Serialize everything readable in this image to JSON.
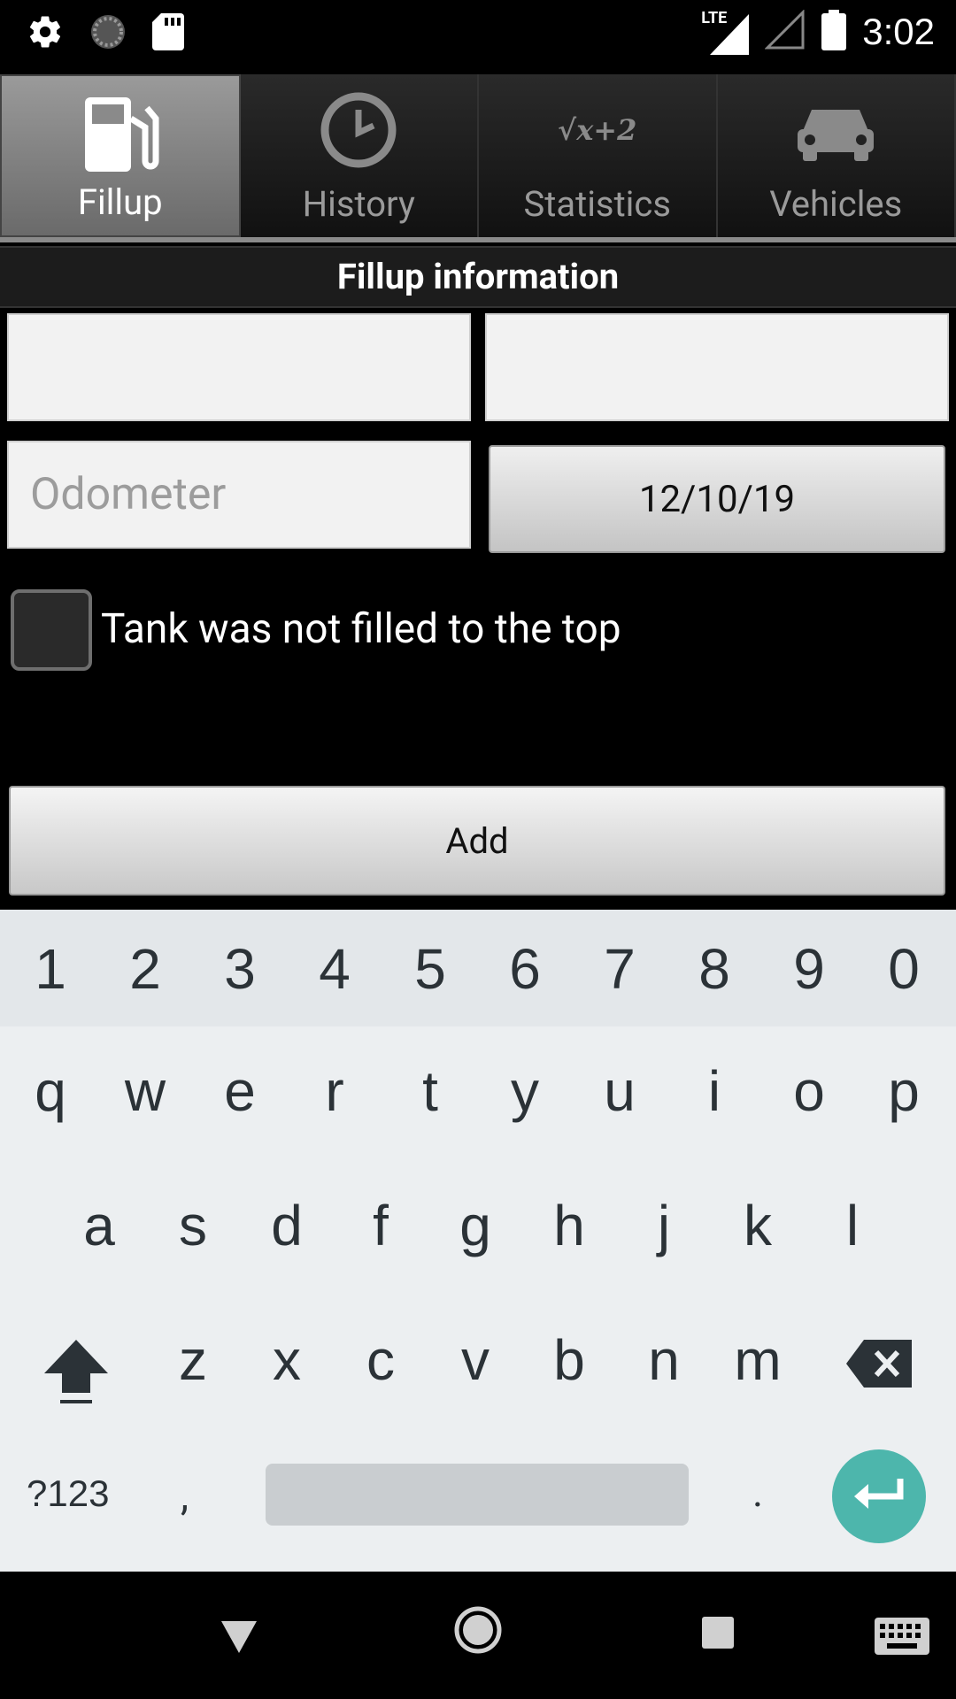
{
  "status_bar": {
    "time": "3:02",
    "network": "LTE",
    "icons": [
      "gear-icon",
      "sync-icon",
      "sd-card-icon",
      "signal-icon",
      "signal-empty-icon",
      "battery-icon"
    ]
  },
  "tabs": [
    {
      "label": "Fillup",
      "icon": "fuel-pump-icon",
      "active": true
    },
    {
      "label": "History",
      "icon": "clock-icon",
      "active": false
    },
    {
      "label": "Statistics",
      "icon": "sqrt-formula-icon",
      "icon_text": "√x+2",
      "active": false
    },
    {
      "label": "Vehicles",
      "icon": "car-icon",
      "active": false
    }
  ],
  "section_header": "Fillup information",
  "form": {
    "field1": {
      "value": "",
      "placeholder": ""
    },
    "field2": {
      "value": "",
      "placeholder": ""
    },
    "odometer": {
      "value": "",
      "placeholder": "Odometer"
    },
    "date": "12/10/19",
    "partial_fill_label": "Tank was not filled to the top",
    "partial_fill_checked": false,
    "add_label": "Add"
  },
  "keyboard": {
    "numbers": [
      "1",
      "2",
      "3",
      "4",
      "5",
      "6",
      "7",
      "8",
      "9",
      "0"
    ],
    "row1": [
      "q",
      "w",
      "e",
      "r",
      "t",
      "y",
      "u",
      "i",
      "o",
      "p"
    ],
    "row2": [
      "a",
      "s",
      "d",
      "f",
      "g",
      "h",
      "j",
      "k",
      "l"
    ],
    "row3": [
      "z",
      "x",
      "c",
      "v",
      "b",
      "n",
      "m"
    ],
    "symbols_label": "?123",
    "comma": ",",
    "period": ".",
    "accent_color": "#4db6ac"
  },
  "nav_bar": {
    "icons": [
      "back-icon",
      "home-icon",
      "recents-icon",
      "keyboard-icon"
    ]
  }
}
